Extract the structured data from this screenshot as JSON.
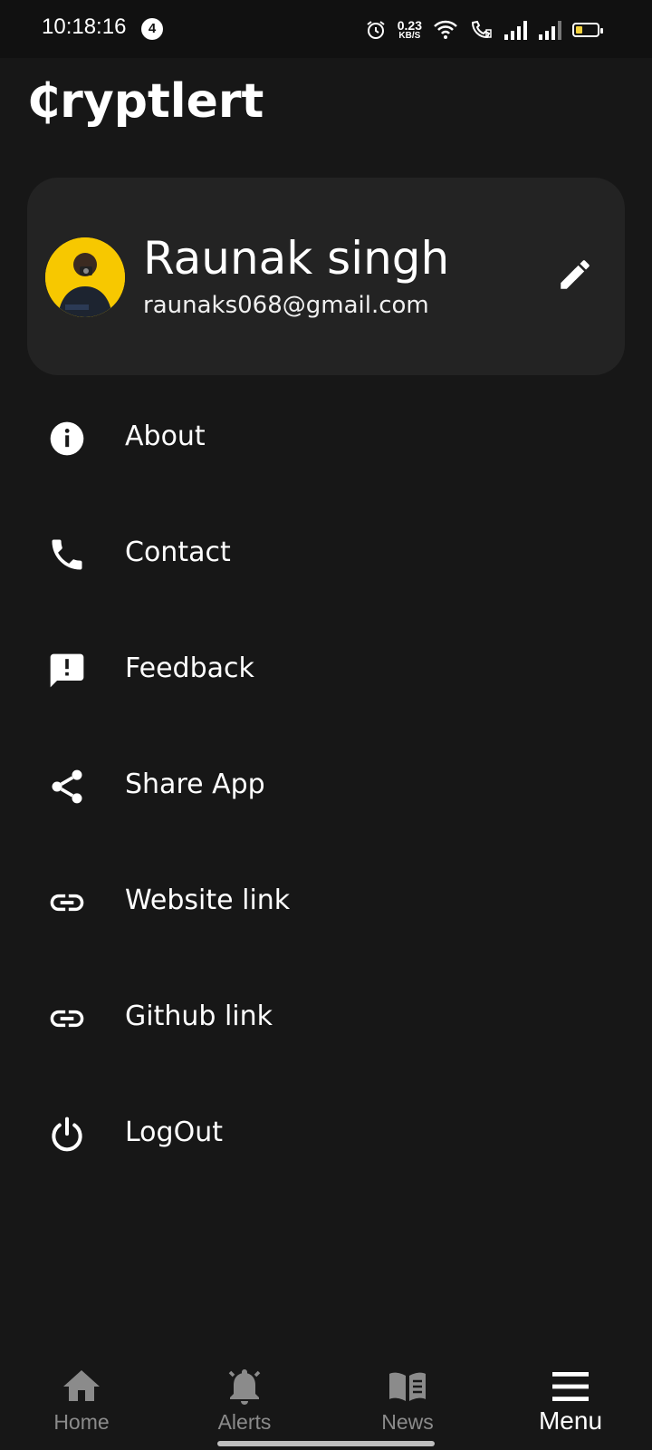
{
  "status_bar": {
    "time": "10:18:16",
    "notification_count": "4",
    "net_speed_value": "0.23",
    "net_speed_unit": "KB/S",
    "battery_level": 0.25
  },
  "app": {
    "logo_text": "₵ryptlert"
  },
  "profile": {
    "name": "Raunak singh",
    "email": "raunaks068@gmail.com",
    "avatar_bg": "#f7c800"
  },
  "menu": {
    "items": [
      {
        "label": "About",
        "icon": "info-icon"
      },
      {
        "label": "Contact",
        "icon": "phone-icon"
      },
      {
        "label": "Feedback",
        "icon": "feedback-icon"
      },
      {
        "label": "Share App",
        "icon": "share-icon"
      },
      {
        "label": "Website link",
        "icon": "link-icon"
      },
      {
        "label": "Github link",
        "icon": "link-icon"
      },
      {
        "label": "LogOut",
        "icon": "power-icon"
      }
    ]
  },
  "bottom_nav": {
    "items": [
      {
        "label": "Home",
        "icon": "home-icon"
      },
      {
        "label": "Alerts",
        "icon": "bell-icon"
      },
      {
        "label": "News",
        "icon": "news-icon"
      },
      {
        "label": "Menu",
        "icon": "menu-icon"
      }
    ],
    "active": "Menu"
  },
  "colors": {
    "background": "#171717",
    "card": "#232323",
    "inactive_nav": "#8b8b8b",
    "active_nav": "#ffffff"
  }
}
